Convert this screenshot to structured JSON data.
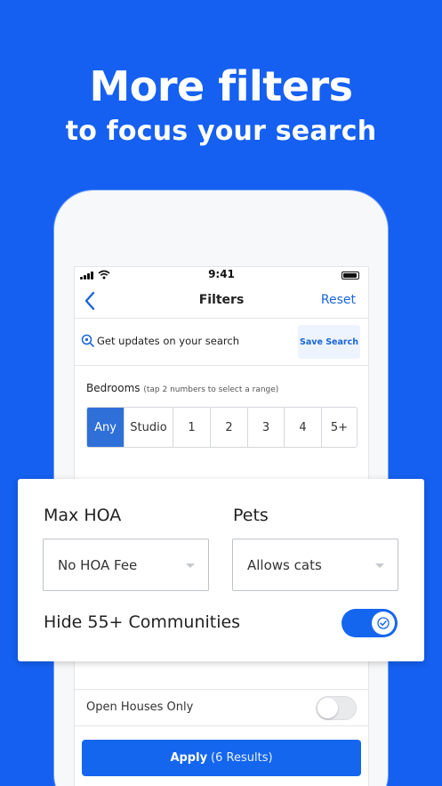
{
  "headline": {
    "line1": "More filters",
    "line2": "to focus your search"
  },
  "status_bar": {
    "time": "9:41"
  },
  "nav": {
    "title": "Filters",
    "reset_label": "Reset",
    "back_icon": "chevron-left-icon"
  },
  "updates": {
    "text": "Get updates on your search",
    "save_label": "Save Search",
    "icon": "search-bell-icon"
  },
  "bedrooms": {
    "label": "Bedrooms",
    "hint": "(tap 2 numbers to select a range)",
    "options": [
      "Any",
      "Studio",
      "1",
      "2",
      "3",
      "4",
      "5+"
    ],
    "selected": "Any"
  },
  "card": {
    "max_hoa": {
      "label": "Max HOA",
      "value": "No HOA Fee"
    },
    "pets": {
      "label": "Pets",
      "value": "Allows cats"
    },
    "hide55": {
      "label": "Hide 55+ Communities",
      "on": true
    }
  },
  "open_houses": {
    "label": "Open Houses Only",
    "on": false
  },
  "apply": {
    "label": "Apply",
    "results": "(6 Results)"
  },
  "colors": {
    "background": "#1560f0",
    "accent": "#1566ee",
    "link": "#1a66d6",
    "segment_active": "#2f6fd8"
  }
}
